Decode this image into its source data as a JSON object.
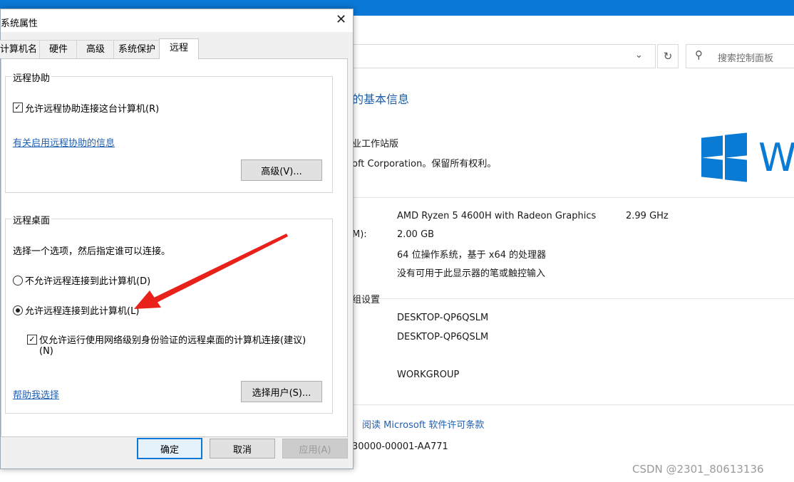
{
  "background": {
    "search_placeholder": "搜索控制面板",
    "heading": "的基本信息",
    "edition": "业工作站版",
    "copyright": "oft Corporation。保留所有权利。",
    "logo_text": "W",
    "processor": "AMD Ryzen 5 4600H with Radeon Graphics",
    "processor_speed": "2.99 GHz",
    "ram_label": "M):",
    "ram": "2.00 GB",
    "system_type": "64 位操作系统，基于 x64 的处理器",
    "pen_touch": "没有可用于此显示器的笔或触控输入",
    "section_settings": "组设置",
    "computer_name": "DESKTOP-QP6QSLM",
    "full_name": "DESKTOP-QP6QSLM",
    "workgroup": "WORKGROUP",
    "license_link": "阅读 Microsoft 软件许可条款",
    "product_id": "30000-00001-AA771"
  },
  "dialog": {
    "title": "系统属性",
    "close": "✕",
    "tabs": [
      "计算机名",
      "硬件",
      "高级",
      "系统保护",
      "远程"
    ],
    "active_tab": "远程",
    "assist": {
      "group_label": "远程协助",
      "allow_checkbox": "允许远程协助连接这台计算机(R)",
      "allow_checked": true,
      "info_link": "有关启用远程协助的信息",
      "advanced_button": "高级(V)..."
    },
    "desktop": {
      "group_label": "远程桌面",
      "instruction": "选择一个选项，然后指定谁可以连接。",
      "option_deny": "不允许远程连接到此计算机(D)",
      "option_allow": "允许远程连接到此计算机(L)",
      "selected": "allow",
      "nla_line1": "仅允许运行使用网络级别身份验证的远程桌面的计算机连接(建议)",
      "nla_line2": "(N)",
      "nla_checked": true,
      "help_link": "帮助我选择",
      "select_users_button": "选择用户(S)..."
    },
    "buttons": {
      "ok": "确定",
      "cancel": "取消",
      "apply": "应用(A)"
    }
  },
  "annotation": {
    "arrow_color": "#e8221a"
  },
  "watermark": "CSDN @2301_80613136",
  "colors": {
    "accent": "#0a78d7",
    "link": "#1f5fb4"
  }
}
